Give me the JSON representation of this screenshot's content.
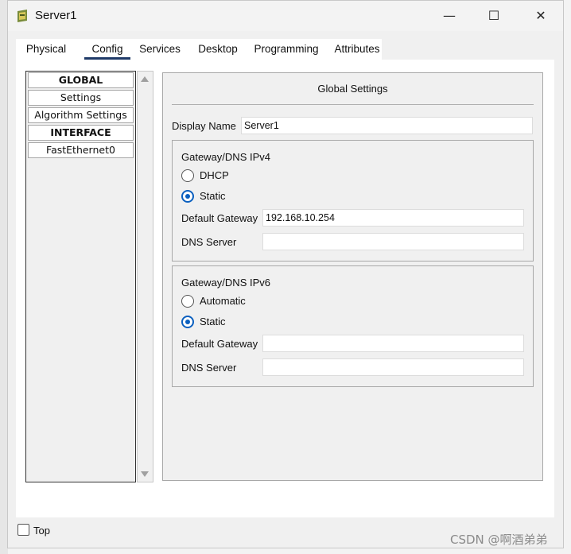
{
  "window": {
    "title": "Server1",
    "minimize_glyph": "—",
    "maximize_glyph": "☐",
    "close_glyph": "✕"
  },
  "tabs": [
    {
      "label": "Physical"
    },
    {
      "label": "Config"
    },
    {
      "label": "Services"
    },
    {
      "label": "Desktop"
    },
    {
      "label": "Programming"
    },
    {
      "label": "Attributes"
    }
  ],
  "active_tab": "Config",
  "sidebar": {
    "items": [
      {
        "label": "GLOBAL"
      },
      {
        "label": "Settings"
      },
      {
        "label": "Algorithm Settings"
      },
      {
        "label": "INTERFACE"
      },
      {
        "label": "FastEthernet0"
      }
    ]
  },
  "global_settings": {
    "title": "Global Settings",
    "display_name_label": "Display Name",
    "display_name_value": "Server1",
    "ipv4": {
      "title": "Gateway/DNS IPv4",
      "dhcp_label": "DHCP",
      "static_label": "Static",
      "selected": "Static",
      "gateway_label": "Default Gateway",
      "gateway_value": "192.168.10.254",
      "dns_label": "DNS Server",
      "dns_value": ""
    },
    "ipv6": {
      "title": "Gateway/DNS IPv6",
      "automatic_label": "Automatic",
      "static_label": "Static",
      "selected": "Static",
      "gateway_label": "Default Gateway",
      "gateway_value": "",
      "dns_label": "DNS Server",
      "dns_value": ""
    }
  },
  "footer": {
    "top_label": "Top",
    "top_checked": false
  },
  "watermark": "CSDN @啊酒弟弟",
  "colors": {
    "accent": "#0a5fbf",
    "tab_underline": "#1f3a68",
    "window_bg": "#f0f0f0"
  }
}
